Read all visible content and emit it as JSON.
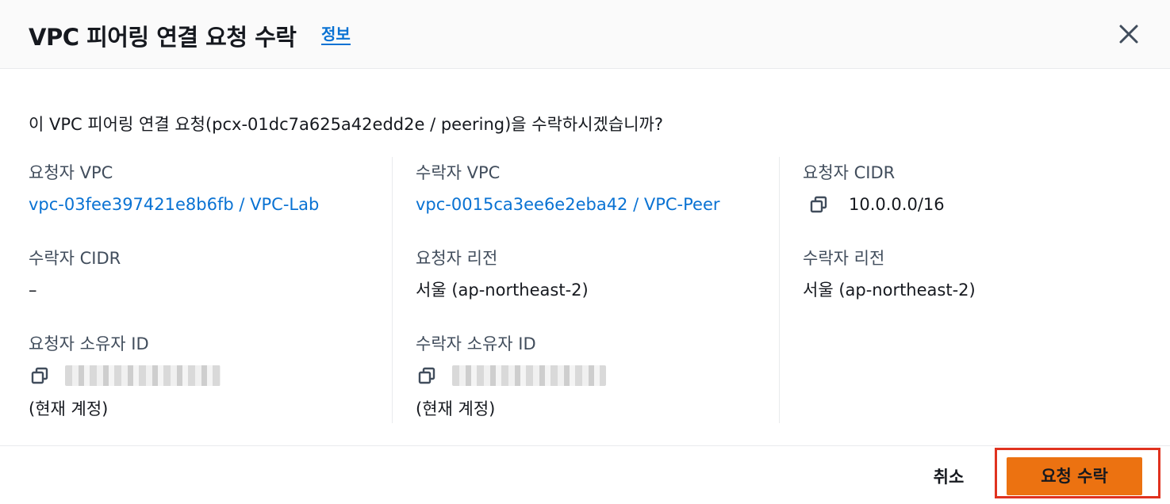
{
  "header": {
    "title": "VPC 피어링 연결 요청 수락",
    "info_link": "정보"
  },
  "question": "이 VPC 피어링 연결 요청(pcx-01dc7a625a42edd2e / peering)을 수락하시겠습니까?",
  "details": {
    "requester_vpc": {
      "label": "요청자 VPC",
      "value": "vpc-03fee397421e8b6fb / VPC-Lab"
    },
    "accepter_vpc": {
      "label": "수락자 VPC",
      "value": "vpc-0015ca3ee6e2eba42 / VPC-Peer"
    },
    "requester_cidr": {
      "label": "요청자 CIDR",
      "value": "10.0.0.0/16"
    },
    "accepter_cidr": {
      "label": "수락자 CIDR",
      "value": "–"
    },
    "requester_region": {
      "label": "요청자 리전",
      "value": "서울 (ap-northeast-2)"
    },
    "accepter_region": {
      "label": "수락자 리전",
      "value": "서울 (ap-northeast-2)"
    },
    "requester_owner": {
      "label": "요청자 소유자 ID",
      "note": "(현재 계정)"
    },
    "accepter_owner": {
      "label": "수락자 소유자 ID",
      "note": "(현재 계정)"
    }
  },
  "footer": {
    "cancel_label": "취소",
    "accept_label": "요청 수락"
  },
  "colors": {
    "link": "#0972d3",
    "primary_button": "#ec7211",
    "highlight": "#e0321f"
  }
}
